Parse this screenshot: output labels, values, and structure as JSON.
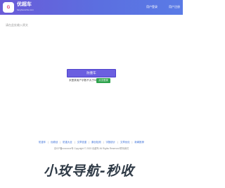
{
  "header": {
    "logo_badge": "G",
    "logo_name": "优超车",
    "logo_sub": "fanghuanche.com",
    "login_label": "用户登录",
    "register_label": "用户注册"
  },
  "editor": {
    "placeholder": "请在此处输入原文"
  },
  "actions": {
    "submit_label": "防重车",
    "limit_text": "未登录用户字数不大于500",
    "upgrade_label": "点击登录"
  },
  "footer": {
    "links": [
      "防重车",
      "伪原创",
      "防重大全",
      "文章查重",
      "原创检测",
      "字数统计",
      "文章优化",
      "新闻推荐"
    ],
    "copyright": "京ICP备xxxxxxxx号 Copyright © 2023 优超车 All Rights Reserved 联系我们"
  },
  "watermark": {
    "text": "小玫导航-秒收"
  },
  "colors": {
    "header_gradient_start": "#6a5bd8",
    "header_gradient_end": "#5a7be6",
    "submit_button": "#6b5fe0",
    "upgrade_button": "#2fa34d",
    "link": "#3a6fd8"
  }
}
